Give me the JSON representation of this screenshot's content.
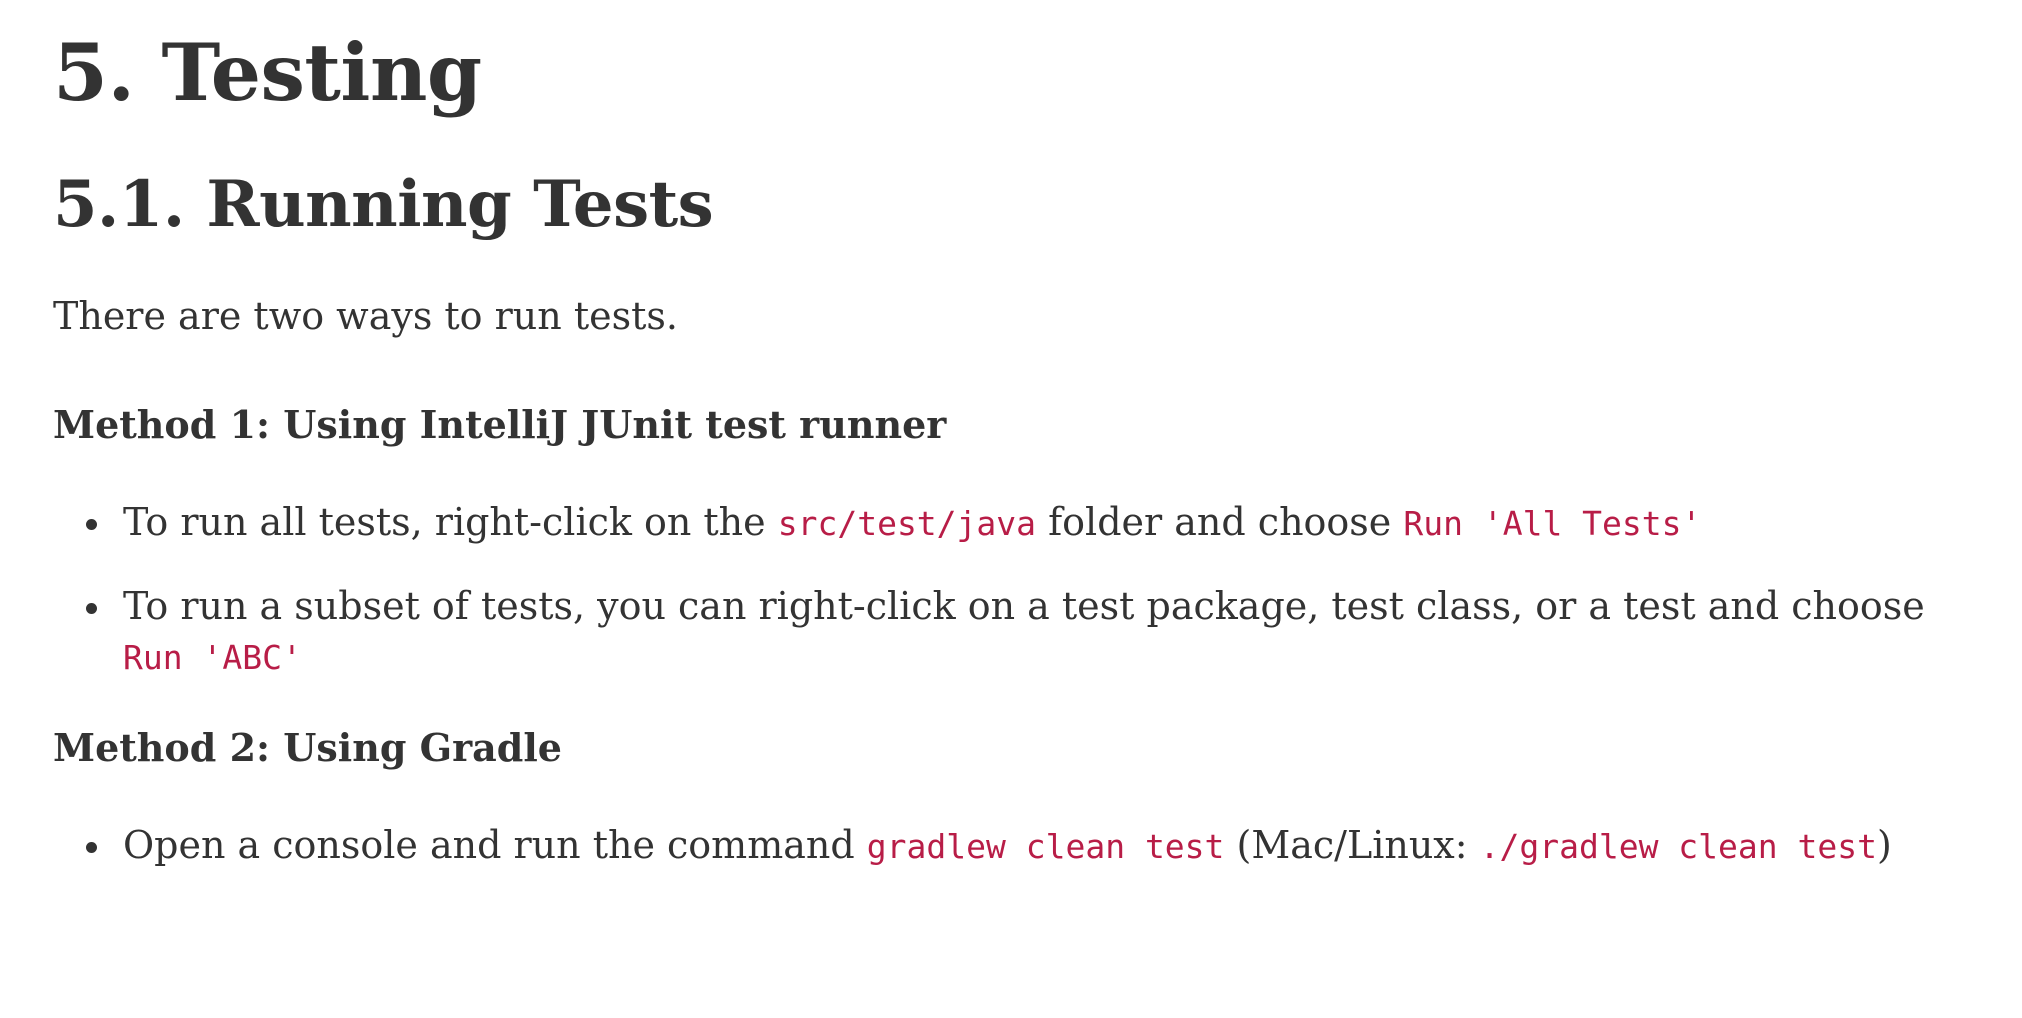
{
  "heading": "5. Testing",
  "subheading": "5.1. Running Tests",
  "intro": "There are two ways to run tests.",
  "method1": {
    "title": "Method 1: Using IntelliJ JUnit test runner",
    "items": [
      {
        "t1": "To run all tests, right-click on the ",
        "c1": "src/test/java",
        "t2": " folder and choose ",
        "c2": "Run 'All Tests'"
      },
      {
        "t1": "To run a subset of tests, you can right-click on a test package, test class, or a test and choose ",
        "c1": "Run 'ABC'"
      }
    ]
  },
  "method2": {
    "title": "Method 2: Using Gradle",
    "items": [
      {
        "t1": "Open a console and run the command ",
        "c1": "gradlew clean test",
        "t2": " (Mac/Linux: ",
        "c2": "./gradlew clean test",
        "t3": ")"
      }
    ]
  }
}
